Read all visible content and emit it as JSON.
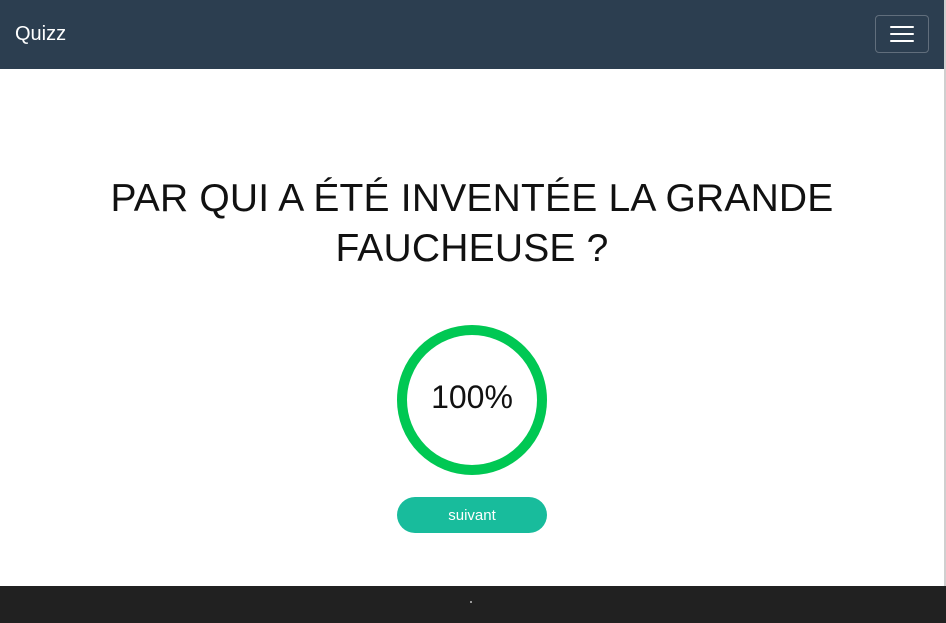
{
  "navbar": {
    "brand": "Quizz",
    "menu_icon": "hamburger-menu-icon"
  },
  "quiz": {
    "question": "PAR QUI A ÉTÉ INVENTÉE LA GRANDE FAUCHEUSE ?",
    "timer": {
      "value_text": "100%",
      "progress": 1.0,
      "color": "#00c853"
    },
    "next_button_label": "suivant"
  },
  "colors": {
    "navbar_bg": "#2c3e50",
    "button_bg": "#18bc9c",
    "footer_bg": "#212121"
  }
}
